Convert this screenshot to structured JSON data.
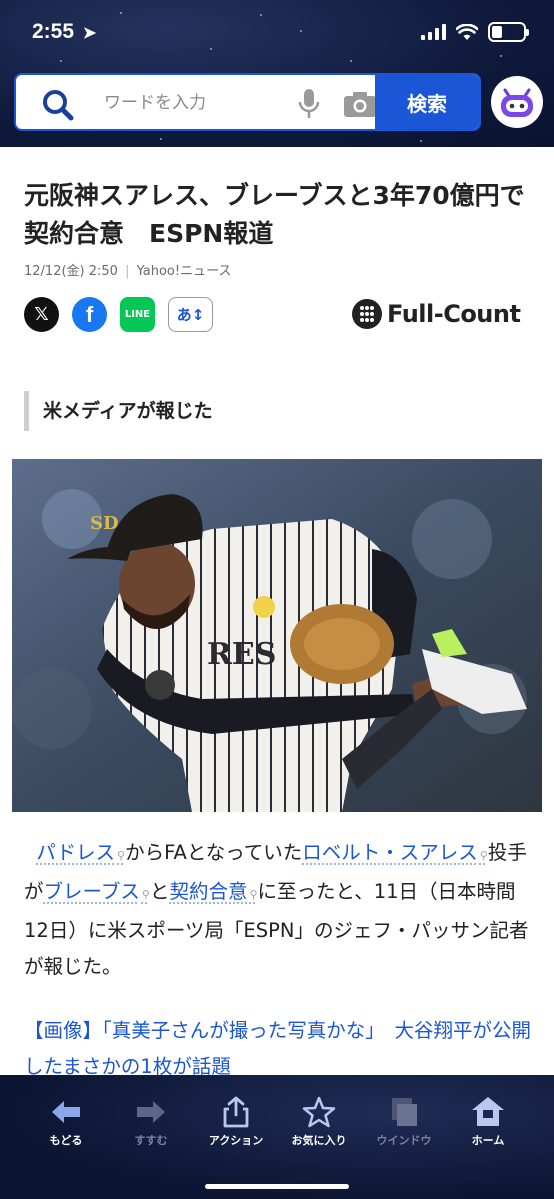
{
  "status_bar": {
    "time": "2:55"
  },
  "search": {
    "placeholder": "ワードを入力",
    "button_label": "検索"
  },
  "article": {
    "headline": "元阪神スアレス、ブレーブスと3年70億円で契約合意　ESPN報道",
    "date": "12/12(金) 2:50",
    "source": "Yahoo!ニュース",
    "share": {
      "x": "𝕏",
      "facebook": "f",
      "line": "LINE",
      "font_size": "あ↕"
    },
    "publisher_logo": "Full-Count",
    "subheading": "米メディアが報じた",
    "body": {
      "kw1": "パドレス",
      "t1": "からFAとなっていた",
      "kw2": "ロベルト・スアレス",
      "t2": "投手が",
      "kw3": "ブレーブス",
      "t3": "と",
      "kw4": "契約合意",
      "t4": "に至ったと、11日（日本時間12日）に米スポーツ局「ESPN」のジェフ・パッサン記者が報じた。"
    },
    "related": "【画像】「真美子さんが撮った写真かな」　大谷翔平が公開したまさかの1枚が話題"
  },
  "toolbar": {
    "back": "もどる",
    "forward": "すすむ",
    "action": "アクション",
    "favorites": "お気に入り",
    "window": "ウインドウ",
    "home": "ホーム"
  },
  "colors": {
    "accent": "#1a56d6",
    "header_bg": "#0f1a3c"
  }
}
